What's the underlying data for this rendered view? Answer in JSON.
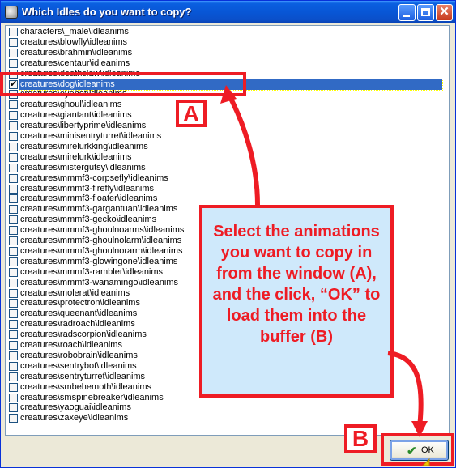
{
  "window": {
    "title": "Which Idles do you want to copy?"
  },
  "list": {
    "items": [
      {
        "label": "characters\\_male\\idleanims",
        "checked": false
      },
      {
        "label": "creatures\\blowfly\\idleanims",
        "checked": false
      },
      {
        "label": "creatures\\brahmin\\idleanims",
        "checked": false
      },
      {
        "label": "creatures\\centaur\\idleanims",
        "checked": false
      },
      {
        "label": "creatures\\deathclaw\\idleanims",
        "checked": false
      },
      {
        "label": "creatures\\dog\\idleanims",
        "checked": true,
        "selected": true
      },
      {
        "label": "creatures\\eyebot\\idleanims",
        "checked": false
      },
      {
        "label": "creatures\\ghoul\\idleanims",
        "checked": false
      },
      {
        "label": "creatures\\giantant\\idleanims",
        "checked": false
      },
      {
        "label": "creatures\\libertyprime\\idleanims",
        "checked": false
      },
      {
        "label": "creatures\\minisentryturret\\idleanims",
        "checked": false
      },
      {
        "label": "creatures\\mirelurkking\\idleanims",
        "checked": false
      },
      {
        "label": "creatures\\mirelurk\\idleanims",
        "checked": false
      },
      {
        "label": "creatures\\mistergutsy\\idleanims",
        "checked": false
      },
      {
        "label": "creatures\\mmmf3-corpsefly\\idleanims",
        "checked": false
      },
      {
        "label": "creatures\\mmmf3-firefly\\idleanims",
        "checked": false
      },
      {
        "label": "creatures\\mmmf3-floater\\idleanims",
        "checked": false
      },
      {
        "label": "creatures\\mmmf3-gargantuan\\idleanims",
        "checked": false
      },
      {
        "label": "creatures\\mmmf3-gecko\\idleanims",
        "checked": false
      },
      {
        "label": "creatures\\mmmf3-ghoulnoarms\\idleanims",
        "checked": false
      },
      {
        "label": "creatures\\mmmf3-ghoulnolarm\\idleanims",
        "checked": false
      },
      {
        "label": "creatures\\mmmf3-ghoulnorarm\\idleanims",
        "checked": false
      },
      {
        "label": "creatures\\mmmf3-glowingone\\idleanims",
        "checked": false
      },
      {
        "label": "creatures\\mmmf3-rambler\\idleanims",
        "checked": false
      },
      {
        "label": "creatures\\mmmf3-wanamingo\\idleanims",
        "checked": false
      },
      {
        "label": "creatures\\molerat\\idleanims",
        "checked": false
      },
      {
        "label": "creatures\\protectron\\idleanims",
        "checked": false
      },
      {
        "label": "creatures\\queenant\\idleanims",
        "checked": false
      },
      {
        "label": "creatures\\radroach\\idleanims",
        "checked": false
      },
      {
        "label": "creatures\\radscorpion\\idleanims",
        "checked": false
      },
      {
        "label": "creatures\\roach\\idleanims",
        "checked": false
      },
      {
        "label": "creatures\\robobrain\\idleanims",
        "checked": false
      },
      {
        "label": "creatures\\sentrybot\\idleanims",
        "checked": false
      },
      {
        "label": "creatures\\sentryturret\\idleanims",
        "checked": false
      },
      {
        "label": "creatures\\smbehemoth\\idleanims",
        "checked": false
      },
      {
        "label": "creatures\\smspinebreaker\\idleanims",
        "checked": false
      },
      {
        "label": "creatures\\yaoguai\\idleanims",
        "checked": false
      },
      {
        "label": "creatures\\zaxeye\\idleanims",
        "checked": false
      }
    ]
  },
  "ok_button": {
    "label": "OK",
    "icon": "check-icon"
  },
  "annotations": {
    "tag_a": "A",
    "tag_b": "B",
    "callout": "Select the animations you want to copy in from the window (A), and the click, “OK” to load them into the buffer (B)",
    "accent_color": "#ee1c24",
    "callout_bg": "#cfe9fb"
  }
}
